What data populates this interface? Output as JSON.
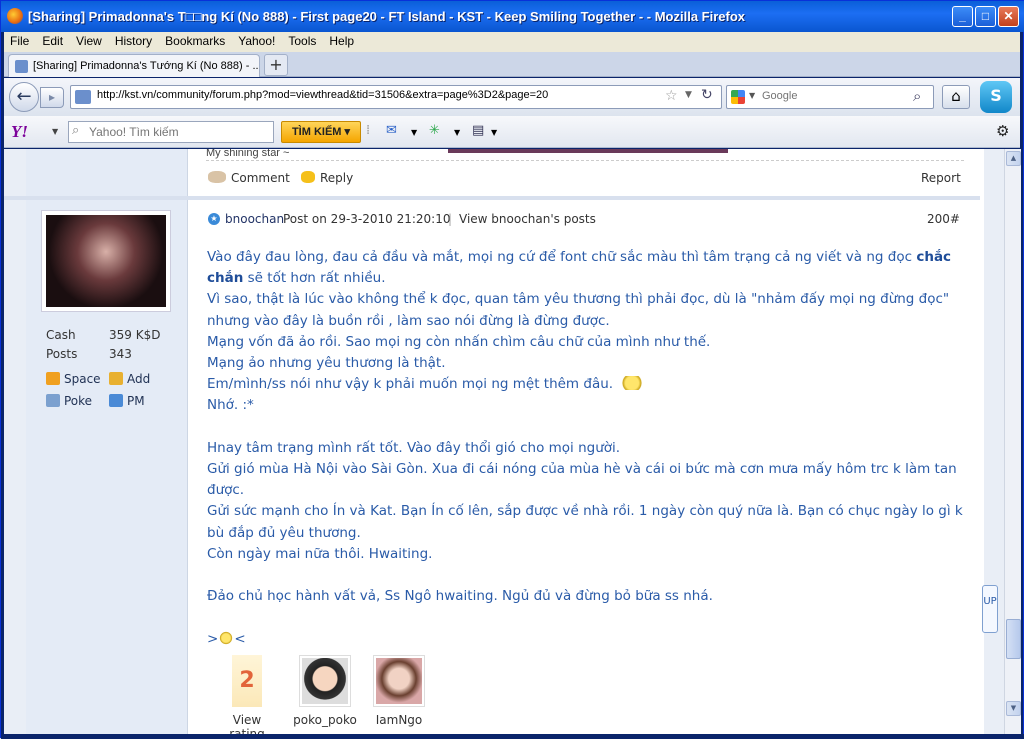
{
  "window": {
    "title": "[Sharing] Primadonna's T□□ng Kí (No 888) - First page20 - FT Island - KST - Keep Smiling Together - - Mozilla Firefox",
    "min": "_",
    "max": "□",
    "close": "✕"
  },
  "menu": [
    "File",
    "Edit",
    "View",
    "History",
    "Bookmarks",
    "Yahoo!",
    "Tools",
    "Help"
  ],
  "tab": {
    "label": "[Sharing] Primadonna's Tướng Kí (No 888) - ...",
    "new_tab": "+"
  },
  "nav": {
    "back": "←",
    "forward": "▸",
    "url": "http://kst.vn/community/forum.php?mod=viewthread&tid=31506&extra=page%3D2&page=20",
    "search_placeholder": "Google",
    "star": "☆",
    "reload": "↻",
    "search_go": "⌕",
    "home": "⌂",
    "skype": "S"
  },
  "yahoo": {
    "logo": "Y!",
    "search_placeholder": "Yahoo! Tìm kiếm",
    "button": "TÌM KIẾM ▾",
    "gear": "⚙"
  },
  "prev_post": {
    "signature": "My shining star ~",
    "comment": "Comment",
    "reply": "Reply",
    "report": "Report"
  },
  "user": {
    "stats": [
      {
        "label": "Cash",
        "value": "359 K$D"
      },
      {
        "label": "Posts",
        "value": "343"
      }
    ],
    "links": [
      "Space",
      "Add",
      "Poke",
      "PM"
    ]
  },
  "post": {
    "author": "bnoochan",
    "posted": "Post on 29-3-2010 21:20:10",
    "sep": "|",
    "view_posts": "View bnoochan's posts",
    "number": "200#",
    "lines": [
      "Vào đây đau lòng, đau cả đầu và mắt, mọi ng cứ để font chữ sắc màu thì tâm trạng cả ng viết và ng đọc",
      "chắc chắn",
      "sẽ tốt hơn rất nhiều.",
      "Vì sao, thật là lúc vào không thể k đọc, quan tâm yêu thương thì phải đọc, dù là \"nhảm đấy mọi ng đừng đọc\" nhưng vào đây là buồn rồi , làm sao nói đừng là đừng được.",
      "Mạng vốn đã ảo rồi. Sao mọi ng còn nhấn chìm câu chữ của mình như thế.",
      "Mạng ảo nhưng yêu thương là thật.",
      "Em/mình/ss nói như vậy k phải muốn mọi ng mệt thêm đâu.",
      "Nhớ. :*",
      "Hnay tâm trạng mình rất tốt. Vào đây thổi gió cho mọi người.",
      "Gửi gió mùa Hà Nội vào Sài Gòn. Xua đi cái nóng của mùa hè và cái oi bức mà cơn mưa mấy hôm trc k làm tan được.",
      "Gửi sức mạnh cho Ín và Kat. Bạn Ín cố lên, sắp được về nhà rồi. 1 ngày còn quý nữa là. Bạn có chục ngày lo gì k bù đắp đủ yêu thương.",
      "Còn ngày mai nữa thôi. Hwaiting.",
      "Đảo chủ học hành vất vả, Ss Ngô hwaiting. Ngủ đủ và đừng bỏ bữa ss nhá.",
      ">",
      "<"
    ]
  },
  "rating": {
    "count": "2",
    "label": "View rating",
    "raters": [
      "poko_poko",
      "IamNgo"
    ]
  },
  "up_tab": "UP",
  "colors": {
    "link": "#2a5ba8",
    "title_bar": "#1c6ef3",
    "yahoo_button": "#f5a500"
  }
}
